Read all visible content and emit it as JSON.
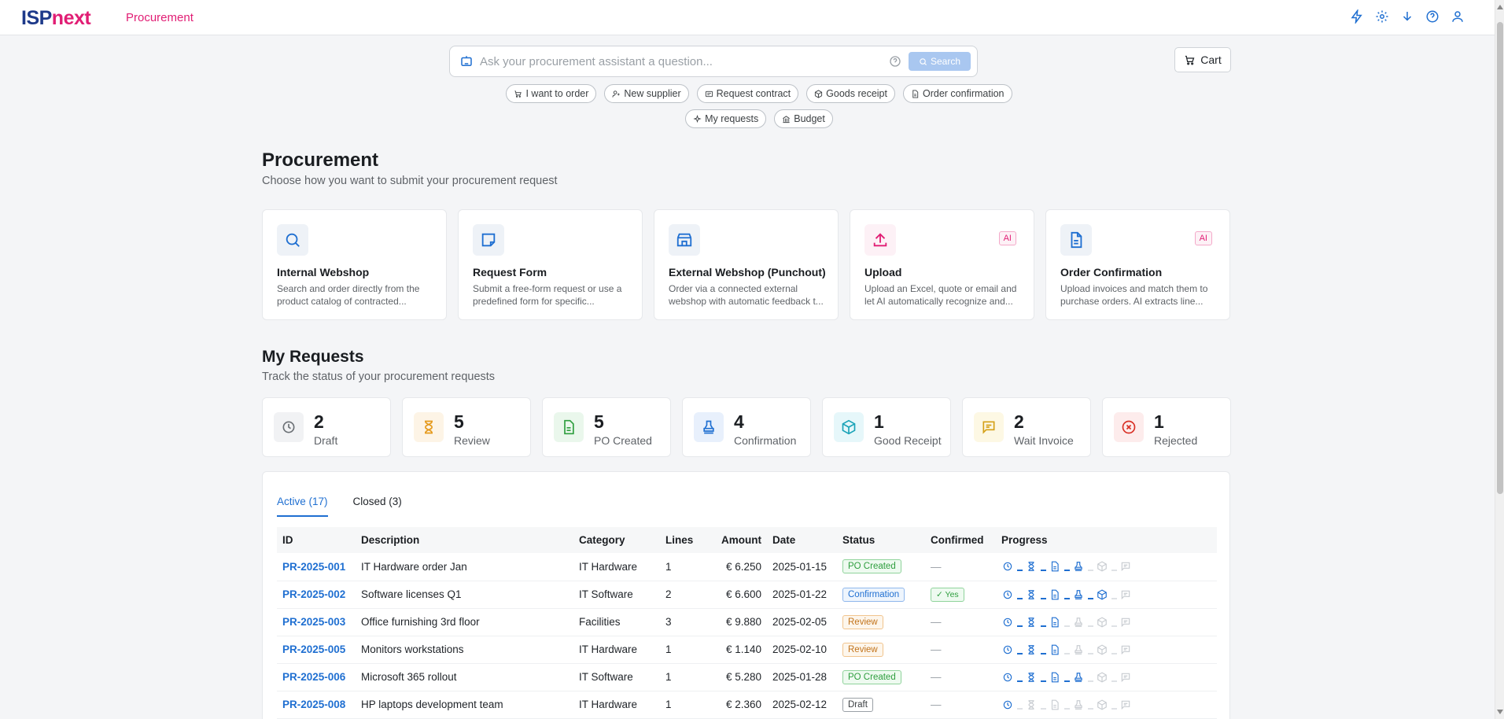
{
  "header": {
    "logo_part1": "ISP",
    "logo_part2": "next",
    "app_name": "Procurement"
  },
  "assistant": {
    "placeholder": "Ask your procurement assistant a question...",
    "search_label": "Search"
  },
  "cart_label": "Cart",
  "chips_row1": [
    "I want to order",
    "New supplier",
    "Request contract",
    "Goods receipt",
    "Order confirmation"
  ],
  "chips_row2": [
    "My requests",
    "Budget"
  ],
  "procurement": {
    "title": "Procurement",
    "subtitle": "Choose how you want to submit your procurement request",
    "cards": [
      {
        "title": "Internal Webshop",
        "desc": "Search and order directly from the product catalog of contracted...",
        "ai": ""
      },
      {
        "title": "Request Form",
        "desc": "Submit a free-form request or use a predefined form for specific...",
        "ai": ""
      },
      {
        "title": "External Webshop (Punchout)",
        "desc": "Order via a connected external webshop with automatic feedback t...",
        "ai": ""
      },
      {
        "title": "Upload",
        "desc": "Upload an Excel, quote or email and let AI automatically recognize and...",
        "ai": "AI"
      },
      {
        "title": "Order Confirmation",
        "desc": "Upload invoices and match them to purchase orders. AI extracts line...",
        "ai": "AI"
      }
    ]
  },
  "requests": {
    "title": "My Requests",
    "subtitle": "Track the status of your procurement requests",
    "stats": [
      {
        "count": "2",
        "label": "Draft"
      },
      {
        "count": "5",
        "label": "Review"
      },
      {
        "count": "5",
        "label": "PO Created"
      },
      {
        "count": "4",
        "label": "Confirmation"
      },
      {
        "count": "1",
        "label": "Good Receipt"
      },
      {
        "count": "2",
        "label": "Wait Invoice"
      },
      {
        "count": "1",
        "label": "Rejected"
      }
    ],
    "tabs": {
      "active": "Active (17)",
      "closed": "Closed (3)"
    },
    "columns": [
      "ID",
      "Description",
      "Category",
      "Lines",
      "Amount",
      "Date",
      "Status",
      "Confirmed",
      "Progress"
    ],
    "rows": [
      {
        "id": "PR-2025-001",
        "description": "IT Hardware order Jan",
        "category": "IT Hardware",
        "lines": "1",
        "amount": "€ 6.250",
        "date": "2025-01-15",
        "status": "PO Created",
        "confirmed": "—",
        "progress_steps": 4
      },
      {
        "id": "PR-2025-002",
        "description": "Software licenses Q1",
        "category": "IT Software",
        "lines": "2",
        "amount": "€ 6.600",
        "date": "2025-01-22",
        "status": "Confirmation",
        "confirmed": "Yes",
        "progress_steps": 5
      },
      {
        "id": "PR-2025-003",
        "description": "Office furnishing 3rd floor",
        "category": "Facilities",
        "lines": "3",
        "amount": "€ 9.880",
        "date": "2025-02-05",
        "status": "Review",
        "confirmed": "—",
        "progress_steps": 3
      },
      {
        "id": "PR-2025-005",
        "description": "Monitors workstations",
        "category": "IT Hardware",
        "lines": "1",
        "amount": "€ 1.140",
        "date": "2025-02-10",
        "status": "Review",
        "confirmed": "—",
        "progress_steps": 3
      },
      {
        "id": "PR-2025-006",
        "description": "Microsoft 365 rollout",
        "category": "IT Software",
        "lines": "1",
        "amount": "€ 5.280",
        "date": "2025-01-28",
        "status": "PO Created",
        "confirmed": "—",
        "progress_steps": 4
      },
      {
        "id": "PR-2025-008",
        "description": "HP laptops development team",
        "category": "IT Hardware",
        "lines": "1",
        "amount": "€ 2.360",
        "date": "2025-02-12",
        "status": "Draft",
        "confirmed": "—",
        "progress_steps": 1
      }
    ]
  },
  "colors": {
    "brand_navy": "#1e3a8a",
    "brand_pink": "#e11d74",
    "accent_blue": "#1f6fd1"
  }
}
